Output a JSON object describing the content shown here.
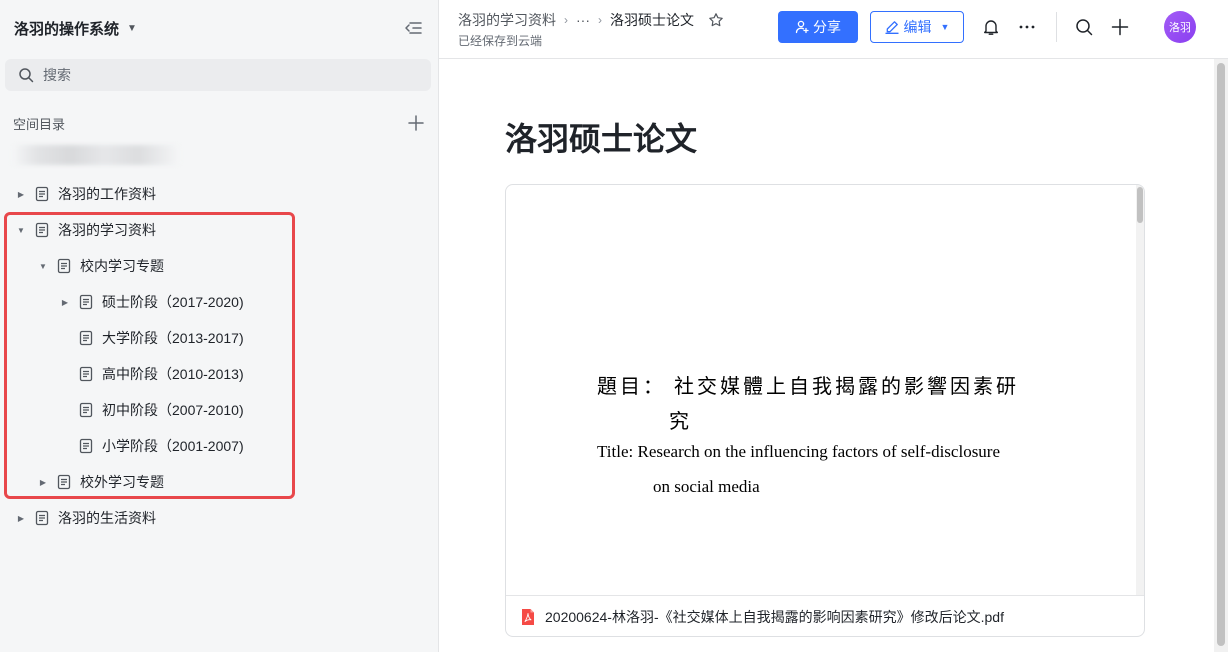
{
  "sidebar": {
    "workspace_title": "洛羽的操作系统",
    "search_placeholder": "搜索",
    "section_label": "空间目录",
    "tree": [
      {
        "label": "洛羽的工作资料"
      },
      {
        "label": "洛羽的学习资料"
      },
      {
        "label": "校内学习专题"
      },
      {
        "label": "硕士阶段（2017-2020)"
      },
      {
        "label": "大学阶段（2013-2017)"
      },
      {
        "label": "高中阶段（2010-2013)"
      },
      {
        "label": "初中阶段（2007-2010)"
      },
      {
        "label": "小学阶段（2001-2007)"
      },
      {
        "label": "校外学习专题"
      },
      {
        "label": "洛羽的生活资料"
      }
    ]
  },
  "topbar": {
    "breadcrumb_parent": "洛羽的学习资料",
    "breadcrumb_ellipsis": "···",
    "breadcrumb_current": "洛羽硕士论文",
    "save_status": "已经保存到云端",
    "share_label": "分享",
    "edit_label": "编辑",
    "avatar_text": "洛羽",
    "accent_color": "#3370ff"
  },
  "main": {
    "doc_title": "洛羽硕士论文",
    "pdf": {
      "cn_title_line1": "題目：  社交媒體上自我揭露的影響因素研",
      "cn_title_line2": "究",
      "en_title_line1": "Title: Research on the influencing factors of self-disclosure",
      "en_title_line2": "on social media",
      "file_name": "20200624-林洛羽-《社交媒体上自我揭露的影响因素研究》修改后论文.pdf"
    }
  }
}
